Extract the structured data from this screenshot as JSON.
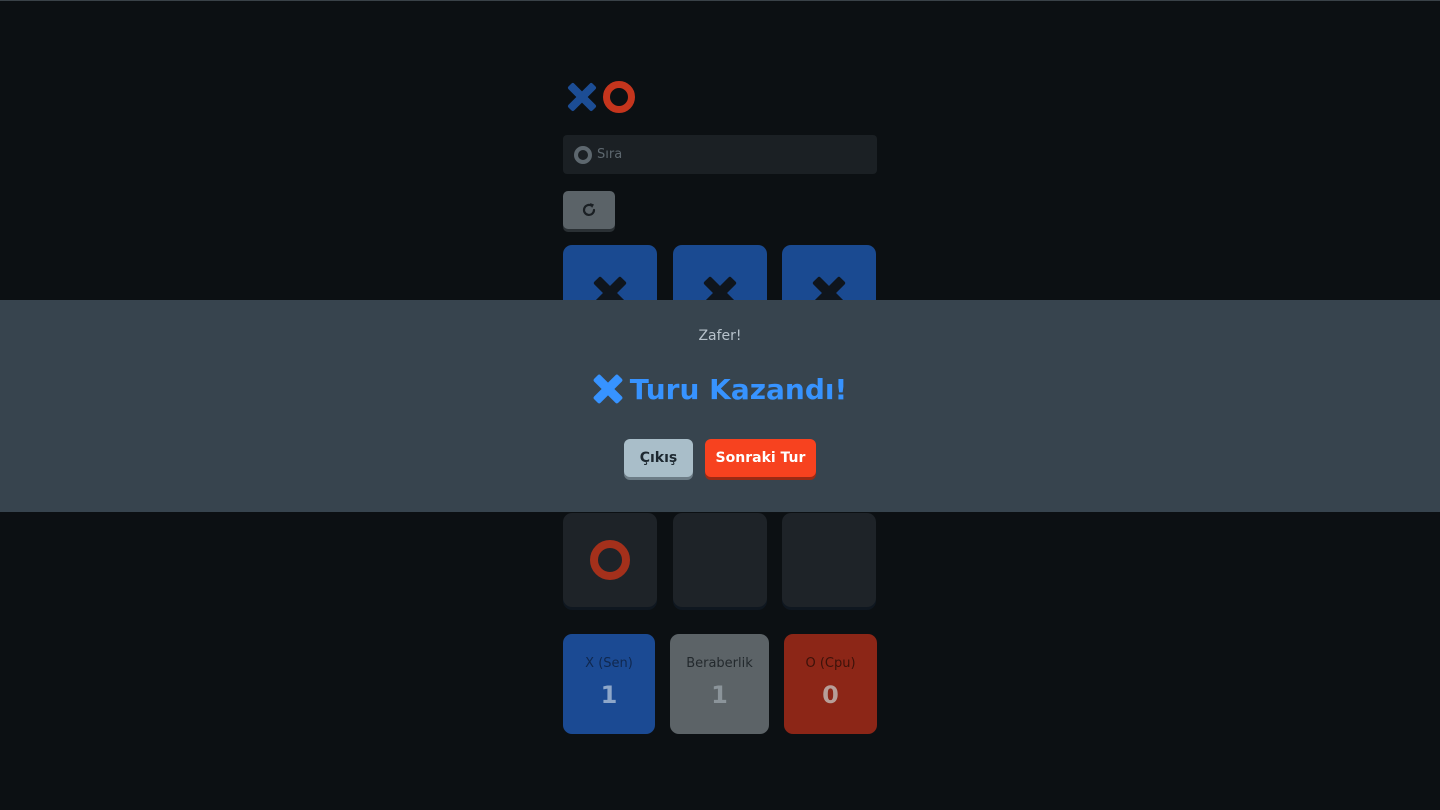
{
  "turn": {
    "label": "Sıra",
    "icon": "o-icon"
  },
  "restart": {
    "icon": "restart-icon"
  },
  "board": {
    "cells": [
      "X",
      "X",
      "X",
      "",
      "",
      "",
      "O",
      "",
      ""
    ]
  },
  "scores": {
    "x": {
      "label": "X (Sen)",
      "value": "1"
    },
    "tie": {
      "label": "Beraberlik",
      "value": "1"
    },
    "o": {
      "label": "O (Cpu)",
      "value": "0"
    }
  },
  "modal": {
    "subtitle": "Zafer!",
    "winner_icon": "x-icon",
    "headline": "Turu Kazandı!",
    "quit_label": "Çıkış",
    "next_label": "Sonraki Tur"
  },
  "colors": {
    "x_accent": "#1a4a91",
    "o_accent": "#c5351d",
    "win_text": "#3793ff",
    "next_button": "#f7421f",
    "quit_button": "#a9bec9",
    "overlay": "#37444e",
    "background": "#0c1013"
  }
}
